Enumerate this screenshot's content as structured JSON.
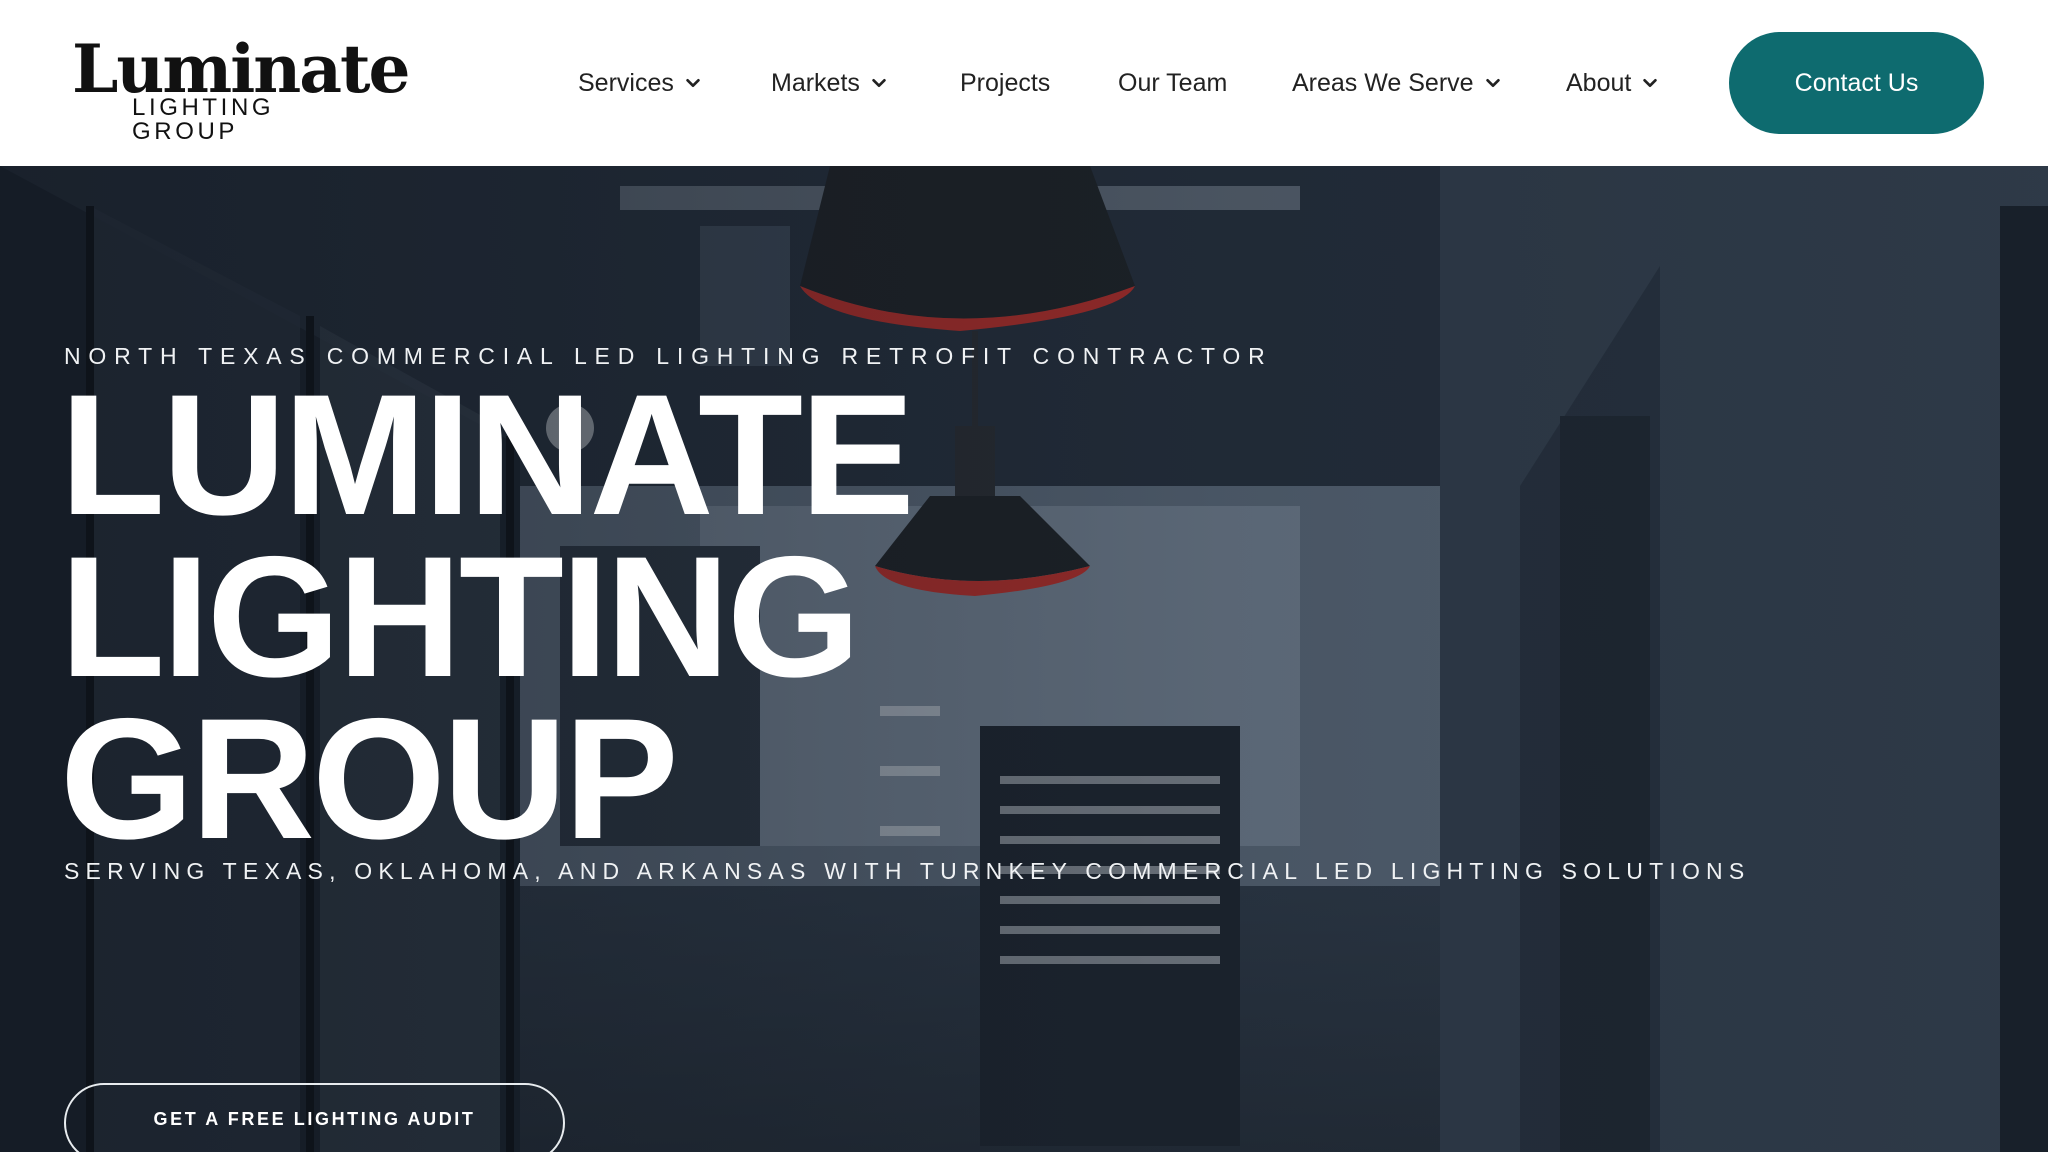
{
  "brand": {
    "name": "Luminate",
    "tagline": "LIGHTING GROUP"
  },
  "nav": {
    "items": [
      {
        "label": "Services",
        "has_dropdown": true
      },
      {
        "label": "Markets",
        "has_dropdown": true
      },
      {
        "label": "Projects",
        "has_dropdown": false
      },
      {
        "label": "Our Team",
        "has_dropdown": false
      },
      {
        "label": "Areas We Serve",
        "has_dropdown": true
      },
      {
        "label": "About",
        "has_dropdown": true
      }
    ],
    "contact_label": "Contact Us"
  },
  "hero": {
    "eyebrow": "NORTH TEXAS COMMERCIAL LED LIGHTING RETROFIT CONTRACTOR",
    "title_lines": [
      "LUMINATE",
      "LIGHTING",
      "GROUP"
    ],
    "subline": "SERVING TEXAS, OKLAHOMA, AND ARKANSAS WITH TURNKEY COMMERCIAL LED LIGHTING SOLUTIONS",
    "cta_label": "GET A FREE LIGHTING AUDIT"
  },
  "colors": {
    "accent": "#0e6b6f",
    "header_bg": "#ffffff",
    "hero_text": "#ffffff",
    "pendant_rim": "#b8302c"
  },
  "icons": {
    "dropdown": "chevron-down-icon"
  }
}
